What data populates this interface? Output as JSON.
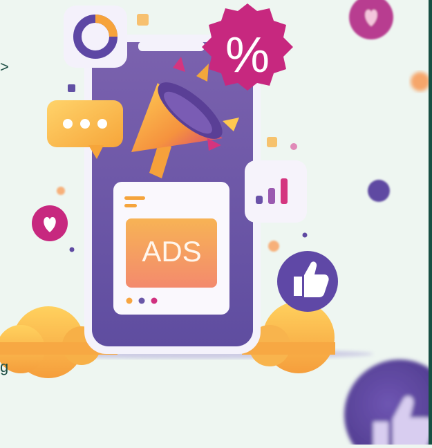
{
  "edge_fragments": {
    "top": ">",
    "bottom": "g"
  },
  "ad_card": {
    "label": "ADS"
  },
  "icons": {
    "percent": "%",
    "chat": "chat-bubble-icon",
    "donut": "donut-chart-icon",
    "bars": "bar-chart-icon",
    "megaphone": "megaphone-icon",
    "like": "thumbs-up-icon",
    "heart": "heart-icon"
  },
  "colors": {
    "background": "#eef6f1",
    "phone": "#6f58a6",
    "accent_pink": "#c7287f",
    "accent_orange": "#f7a541",
    "accent_purple": "#5b3f97"
  }
}
